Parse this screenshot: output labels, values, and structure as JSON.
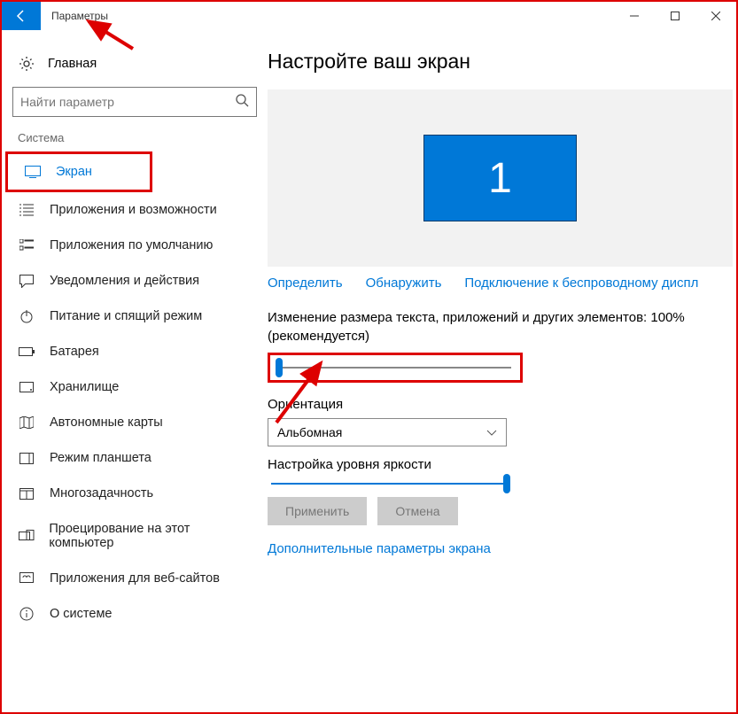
{
  "titlebar": {
    "title": "Параметры"
  },
  "sidebar": {
    "home_label": "Главная",
    "search_placeholder": "Найти параметр",
    "section_label": "Система",
    "items": [
      {
        "label": "Экран"
      },
      {
        "label": "Приложения и возможности"
      },
      {
        "label": "Приложения по умолчанию"
      },
      {
        "label": "Уведомления и действия"
      },
      {
        "label": "Питание и спящий режим"
      },
      {
        "label": "Батарея"
      },
      {
        "label": "Хранилище"
      },
      {
        "label": "Автономные карты"
      },
      {
        "label": "Режим планшета"
      },
      {
        "label": "Многозадачность"
      },
      {
        "label": "Проецирование на этот компьютер"
      },
      {
        "label": "Приложения для веб-сайтов"
      },
      {
        "label": "О системе"
      }
    ]
  },
  "main": {
    "title": "Настройте ваш экран",
    "monitor_number": "1",
    "links": {
      "identify": "Определить",
      "detect": "Обнаружить",
      "wireless": "Подключение к беспроводному диспл"
    },
    "scale_label": "Изменение размера текста, приложений и других элементов: 100% (рекомендуется)",
    "orientation_label": "Ориентация",
    "orientation_value": "Альбомная",
    "brightness_label": "Настройка уровня яркости",
    "apply_btn": "Применить",
    "cancel_btn": "Отмена",
    "advanced_link": "Дополнительные параметры экрана"
  }
}
